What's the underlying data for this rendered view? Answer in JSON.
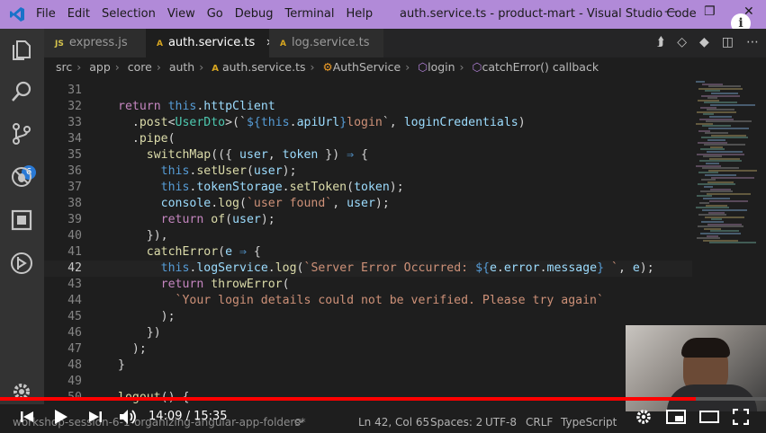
{
  "window": {
    "title": "auth.service.ts - product-mart - Visual Studio Code",
    "menu": [
      "File",
      "Edit",
      "Selection",
      "View",
      "Go",
      "Debug",
      "Terminal",
      "Help"
    ],
    "controls": {
      "minimize": "—",
      "maximize": "❐",
      "close": "✕"
    }
  },
  "activity_bar": {
    "items": [
      "explorer-icon",
      "search-icon",
      "source-control-icon",
      "debug-icon",
      "extensions-icon",
      "remote-icon",
      "settings-gear-icon"
    ],
    "source_control_badge": "6"
  },
  "tabs": [
    {
      "label": "express.js",
      "icon_text": "JS",
      "icon_color": "#d6c44d",
      "active": false,
      "close": ""
    },
    {
      "label": "auth.service.ts",
      "icon_text": "A",
      "icon_color": "#d6a520",
      "active": true,
      "close": "✕"
    },
    {
      "label": "log.service.ts",
      "icon_text": "A",
      "icon_color": "#d6a520",
      "active": false,
      "close": ""
    }
  ],
  "breadcrumb": [
    "src",
    "app",
    "core",
    "auth",
    "auth.service.ts",
    "AuthService",
    "login",
    "catchError() callback"
  ],
  "code_lines": [
    {
      "n": "31",
      "tokens": []
    },
    {
      "n": "32",
      "tokens": [
        [
          "k",
          "return "
        ],
        [
          "kw",
          "this"
        ],
        [
          "p",
          "."
        ],
        [
          "v",
          "httpClient"
        ]
      ]
    },
    {
      "n": "33",
      "tokens": [
        [
          "p",
          "  ."
        ],
        [
          "f",
          "post"
        ],
        [
          "p",
          "<"
        ],
        [
          "t",
          "UserDto"
        ],
        [
          "p",
          ">(`"
        ],
        [
          "kw",
          "${"
        ],
        [
          "kw",
          "this"
        ],
        [
          "p",
          "."
        ],
        [
          "v",
          "apiUrl"
        ],
        [
          "kw",
          "}"
        ],
        [
          "s",
          "login"
        ],
        [
          "p",
          "`, "
        ],
        [
          "v",
          "loginCredentials"
        ],
        [
          "p",
          ")"
        ]
      ]
    },
    {
      "n": "34",
      "tokens": [
        [
          "p",
          "  ."
        ],
        [
          "f",
          "pipe"
        ],
        [
          "p",
          "("
        ]
      ]
    },
    {
      "n": "35",
      "tokens": [
        [
          "p",
          "    "
        ],
        [
          "f",
          "switchMap"
        ],
        [
          "p",
          "(({ "
        ],
        [
          "v",
          "user"
        ],
        [
          "p",
          ", "
        ],
        [
          "v",
          "token"
        ],
        [
          "p",
          " }) "
        ],
        [
          "kw",
          "⇒"
        ],
        [
          "p",
          " {"
        ]
      ]
    },
    {
      "n": "36",
      "tokens": [
        [
          "p",
          "      "
        ],
        [
          "kw",
          "this"
        ],
        [
          "p",
          "."
        ],
        [
          "f",
          "setUser"
        ],
        [
          "p",
          "("
        ],
        [
          "v",
          "user"
        ],
        [
          "p",
          ");"
        ]
      ]
    },
    {
      "n": "37",
      "tokens": [
        [
          "p",
          "      "
        ],
        [
          "kw",
          "this"
        ],
        [
          "p",
          "."
        ],
        [
          "v",
          "tokenStorage"
        ],
        [
          "p",
          "."
        ],
        [
          "f",
          "setToken"
        ],
        [
          "p",
          "("
        ],
        [
          "v",
          "token"
        ],
        [
          "p",
          ");"
        ]
      ]
    },
    {
      "n": "38",
      "tokens": [
        [
          "p",
          "      "
        ],
        [
          "v",
          "console"
        ],
        [
          "p",
          "."
        ],
        [
          "f",
          "log"
        ],
        [
          "p",
          "("
        ],
        [
          "s",
          "`user found`"
        ],
        [
          "p",
          ", "
        ],
        [
          "v",
          "user"
        ],
        [
          "p",
          ");"
        ]
      ]
    },
    {
      "n": "39",
      "tokens": [
        [
          "p",
          "      "
        ],
        [
          "k",
          "return "
        ],
        [
          "f",
          "of"
        ],
        [
          "p",
          "("
        ],
        [
          "v",
          "user"
        ],
        [
          "p",
          ");"
        ]
      ]
    },
    {
      "n": "40",
      "tokens": [
        [
          "p",
          "    }),"
        ]
      ]
    },
    {
      "n": "41",
      "tokens": [
        [
          "p",
          "    "
        ],
        [
          "f",
          "catchError"
        ],
        [
          "p",
          "("
        ],
        [
          "v",
          "e"
        ],
        [
          "p",
          " "
        ],
        [
          "kw",
          "⇒"
        ],
        [
          "p",
          " {"
        ]
      ]
    },
    {
      "n": "42",
      "tokens": [
        [
          "p",
          "      "
        ],
        [
          "kw",
          "this"
        ],
        [
          "p",
          "."
        ],
        [
          "v",
          "logService"
        ],
        [
          "p",
          "."
        ],
        [
          "f",
          "log"
        ],
        [
          "p",
          "("
        ],
        [
          "s",
          "`Server Error Occurred: "
        ],
        [
          "kw",
          "${"
        ],
        [
          "v",
          "e"
        ],
        [
          "p",
          "."
        ],
        [
          "v",
          "error"
        ],
        [
          "p",
          "."
        ],
        [
          "v",
          "message"
        ],
        [
          "kw",
          "}"
        ],
        [
          "s",
          " `"
        ],
        [
          "p",
          ", "
        ],
        [
          "v",
          "e"
        ],
        [
          "p",
          ");"
        ]
      ],
      "active": true
    },
    {
      "n": "43",
      "tokens": [
        [
          "p",
          "      "
        ],
        [
          "k",
          "return "
        ],
        [
          "f",
          "throwError"
        ],
        [
          "p",
          "("
        ]
      ]
    },
    {
      "n": "44",
      "tokens": [
        [
          "p",
          "        "
        ],
        [
          "s",
          "`Your login details could not be verified. Please try again`"
        ]
      ]
    },
    {
      "n": "45",
      "tokens": [
        [
          "p",
          "      );"
        ]
      ]
    },
    {
      "n": "46",
      "tokens": [
        [
          "p",
          "    })"
        ]
      ]
    },
    {
      "n": "47",
      "tokens": [
        [
          "p",
          "  );"
        ]
      ]
    },
    {
      "n": "48",
      "tokens": [
        [
          "p",
          "}"
        ]
      ]
    },
    {
      "n": "49",
      "tokens": []
    },
    {
      "n": "50",
      "tokens": [
        [
          "f",
          "logout"
        ],
        [
          "p",
          "() {"
        ]
      ]
    }
  ],
  "statusbar": {
    "branch": "workshop-session-6-1-organizing-angular-app-folders*",
    "position": "Ln 42, Col 65",
    "spaces": "Spaces: 2",
    "encoding": "UTF-8",
    "eol": "CRLF",
    "language": "TypeScript"
  },
  "player": {
    "time": "14:09 / 15:35",
    "progress": 0.908,
    "icons": [
      "prev-icon",
      "play-icon",
      "next-icon",
      "volume-icon",
      "settings-icon",
      "miniplayer-icon",
      "theater-icon",
      "fullscreen-icon"
    ]
  },
  "info_icon": "i"
}
